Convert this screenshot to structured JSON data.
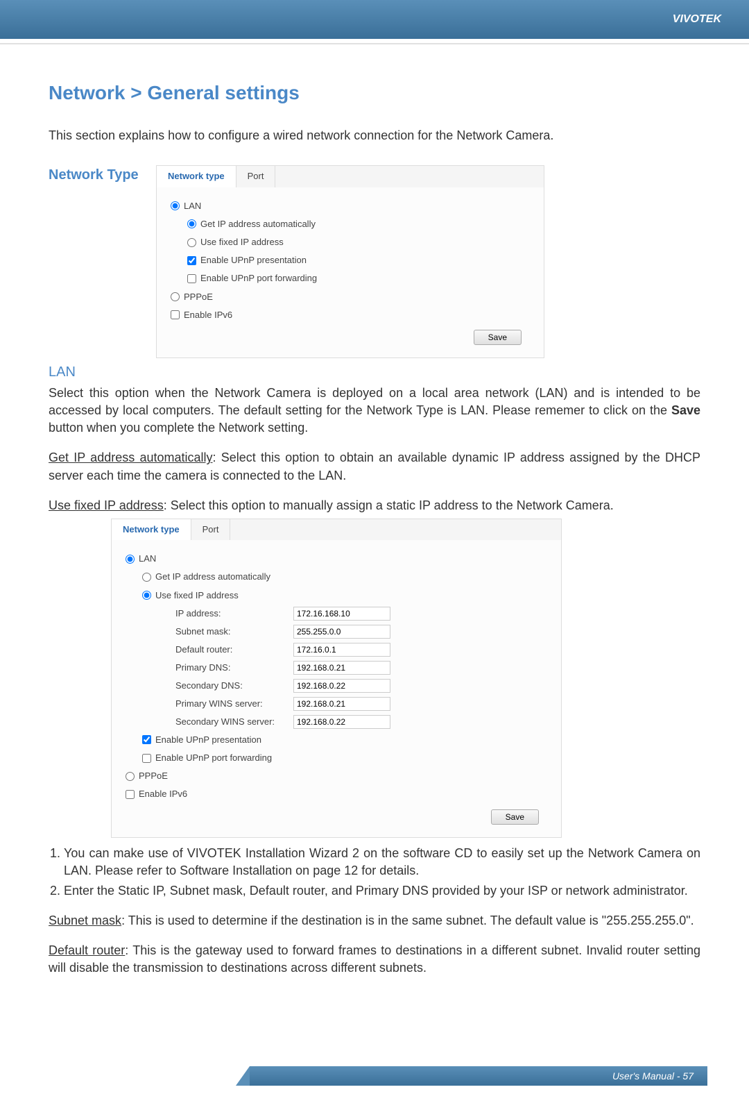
{
  "header": {
    "brand": "VIVOTEK"
  },
  "page": {
    "title": "Network > General settings",
    "intro": "This section explains how to configure a wired network connection for the Network Camera."
  },
  "sections": {
    "network_type_label": "Network Type",
    "lan_label": "LAN"
  },
  "panel1": {
    "tabs": {
      "network_type": "Network type",
      "port": "Port"
    },
    "lan": "LAN",
    "get_ip_auto": "Get IP address automatically",
    "use_fixed": "Use fixed IP address",
    "enable_upnp_pres": "Enable UPnP presentation",
    "enable_upnp_fwd": "Enable UPnP port forwarding",
    "pppoe": "PPPoE",
    "enable_ipv6": "Enable IPv6",
    "save": "Save"
  },
  "text": {
    "lan_desc": "Select this option when the Network Camera is deployed on a local area network (LAN) and is intended to be accessed by local computers. The default setting for the Network Type is LAN. Please rememer to click on the ",
    "save_word": "Save",
    "lan_desc2": " button when you complete the Network setting.",
    "get_ip_auto_label": "Get IP address automatically",
    "get_ip_auto_desc": ": Select this option to obtain an available dynamic IP address assigned by the DHCP server each time the camera is connected to the LAN.",
    "use_fixed_label": "Use fixed IP address",
    "use_fixed_desc": ": Select this option to manually assign a static IP address to the Network Camera.",
    "li1": "You can make use of VIVOTEK Installation Wizard 2 on the software CD to easily set up the Network Camera on LAN. Please refer to Software Installation on page 12 for details.",
    "li2": "Enter the Static IP, Subnet mask, Default router, and Primary DNS provided by your ISP or network administrator.",
    "subnet_label": "Subnet mask",
    "subnet_desc": ": This is used to determine if the destination is in the same subnet. The default value is \"255.255.255.0\".",
    "default_router_label": "Default router",
    "default_router_desc": ": This is the gateway used to forward frames to destinations in a different subnet. Invalid router setting will disable the transmission to destinations across different subnets."
  },
  "panel2": {
    "tabs": {
      "network_type": "Network type",
      "port": "Port"
    },
    "lan": "LAN",
    "get_ip_auto": "Get IP address automatically",
    "use_fixed": "Use fixed IP address",
    "fields": {
      "ip_address": {
        "label": "IP address:",
        "value": "172.16.168.10"
      },
      "subnet_mask": {
        "label": "Subnet mask:",
        "value": "255.255.0.0"
      },
      "default_router": {
        "label": "Default router:",
        "value": "172.16.0.1"
      },
      "primary_dns": {
        "label": "Primary DNS:",
        "value": "192.168.0.21"
      },
      "secondary_dns": {
        "label": "Secondary DNS:",
        "value": "192.168.0.22"
      },
      "primary_wins": {
        "label": "Primary WINS server:",
        "value": "192.168.0.21"
      },
      "secondary_wins": {
        "label": "Secondary WINS server:",
        "value": "192.168.0.22"
      }
    },
    "enable_upnp_pres": "Enable UPnP presentation",
    "enable_upnp_fwd": "Enable UPnP port forwarding",
    "pppoe": "PPPoE",
    "enable_ipv6": "Enable IPv6",
    "save": "Save"
  },
  "footer": {
    "text": "User's Manual - 57"
  }
}
